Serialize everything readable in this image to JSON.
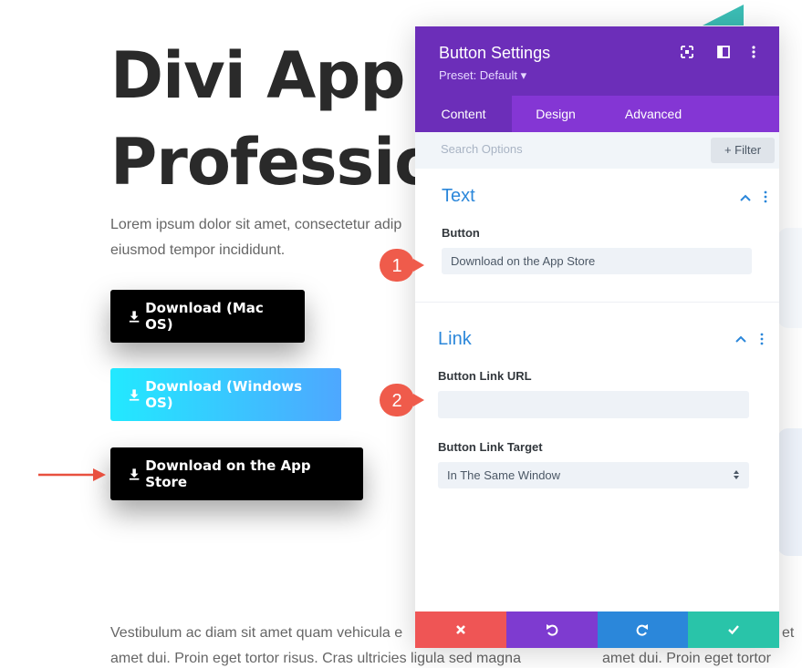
{
  "page": {
    "hero_line_1": "Divi App f",
    "hero_line_2": "Professio",
    "intro_line_1": "Lorem ipsum dolor sit amet, consectetur adip",
    "intro_line_2": "eiusmod tempor incididunt.",
    "buttons": [
      {
        "label": "Download (Mac OS)"
      },
      {
        "label": "Download (Windows OS)"
      },
      {
        "label": "Download on the App Store"
      }
    ],
    "footer_left_line_1": "Vestibulum ac diam sit amet quam vehicula e",
    "footer_left_line_2": "amet dui. Proin eget tortor risus. Cras ultricies ligula sed magna",
    "footer_right_line_1": "et",
    "footer_right_line_2": "amet dui. Proin eget tortor"
  },
  "panel": {
    "title": "Button Settings",
    "preset": "Preset: Default ▾",
    "tabs": [
      {
        "label": "Content"
      },
      {
        "label": "Design"
      },
      {
        "label": "Advanced"
      }
    ],
    "search_placeholder": "Search Options",
    "filter_label": "+ Filter",
    "sections": {
      "text": {
        "title": "Text",
        "button_label": "Button",
        "button_value": "Download on the App Store"
      },
      "link": {
        "title": "Link",
        "url_label": "Button Link URL",
        "url_value": "",
        "target_label": "Button Link Target",
        "target_value": "In The Same Window"
      }
    },
    "badges": [
      "1",
      "2"
    ]
  },
  "colors": {
    "panel_header": "#6c2eb9",
    "panel_tabs": "#8436d4",
    "accent_blue": "#2b87da",
    "cancel": "#ef5555",
    "undo": "#7e3bd0",
    "redo": "#2b87da",
    "save": "#29c4a9",
    "badge": "#ef5b4b"
  },
  "icons": [
    "download-icon",
    "arrow-right-icon",
    "expand-icon",
    "split-view-icon",
    "more-vertical-icon",
    "chevron-up-icon",
    "close-icon",
    "undo-icon",
    "redo-icon",
    "check-icon"
  ]
}
